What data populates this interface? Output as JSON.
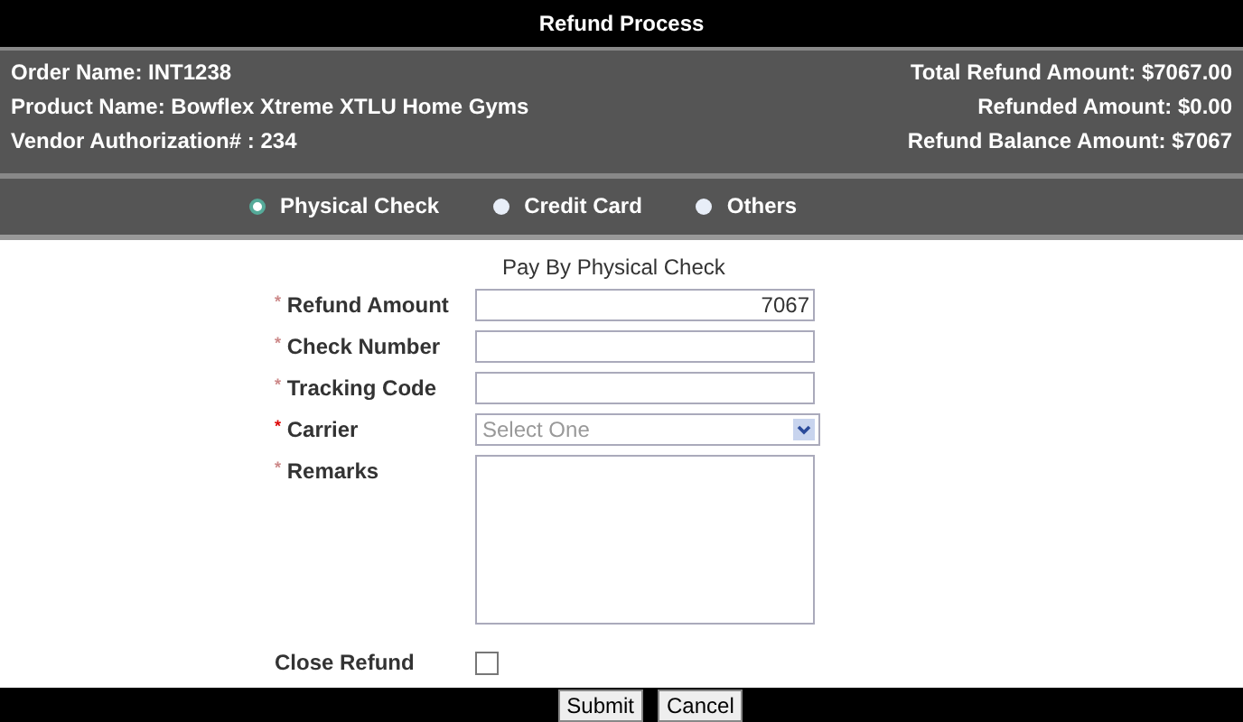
{
  "window": {
    "title": "Refund Process"
  },
  "info_left": [
    "Order Name: INT1238",
    "Product Name: Bowflex Xtreme XTLU Home Gyms",
    "Vendor Authorization# : 234"
  ],
  "info_right": [
    "Total Refund Amount: $7067.00",
    "Refunded Amount: $0.00",
    "Refund Balance Amount: $7067"
  ],
  "payment_methods": [
    {
      "label": "Physical Check",
      "selected": true
    },
    {
      "label": "Credit Card",
      "selected": false
    },
    {
      "label": "Others",
      "selected": false
    }
  ],
  "form_title": "Pay By Physical Check",
  "fields": [
    {
      "kind": "text",
      "mark": "*",
      "label": "Refund Amount",
      "value": "7067"
    },
    {
      "kind": "text",
      "mark": "*",
      "label": "Check Number"
    },
    {
      "kind": "text",
      "mark": "*",
      "label": "Tracking Code"
    },
    {
      "kind": "select",
      "mark": "*",
      "label": "Carrier",
      "placeholder": "Select One"
    },
    {
      "kind": "textarea",
      "mark": "*",
      "label": "Remarks"
    },
    {
      "kind": "checkbox",
      "label": "Close Refund",
      "checked": false
    }
  ],
  "buttons": [
    "Submit",
    "Cancel"
  ]
}
